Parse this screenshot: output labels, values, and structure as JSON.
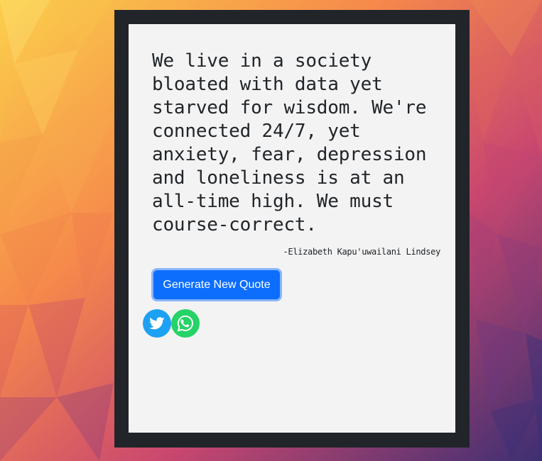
{
  "quote": {
    "text": "We live in a society bloated with data yet starved for wisdom. We're connected 24/7, yet anxiety, fear, depression and loneliness is at an all-time high. We must course-correct.",
    "author": "-Elizabeth Kapu'uwailani Lindsey"
  },
  "actions": {
    "generate_label": "Generate New Quote",
    "share_icons": [
      "twitter-icon",
      "whatsapp-icon"
    ]
  },
  "colors": {
    "button": "#0d6efd",
    "twitter": "#1da1f2",
    "whatsapp": "#25d366",
    "frame": "#212529",
    "card": "#f3f3f3"
  }
}
